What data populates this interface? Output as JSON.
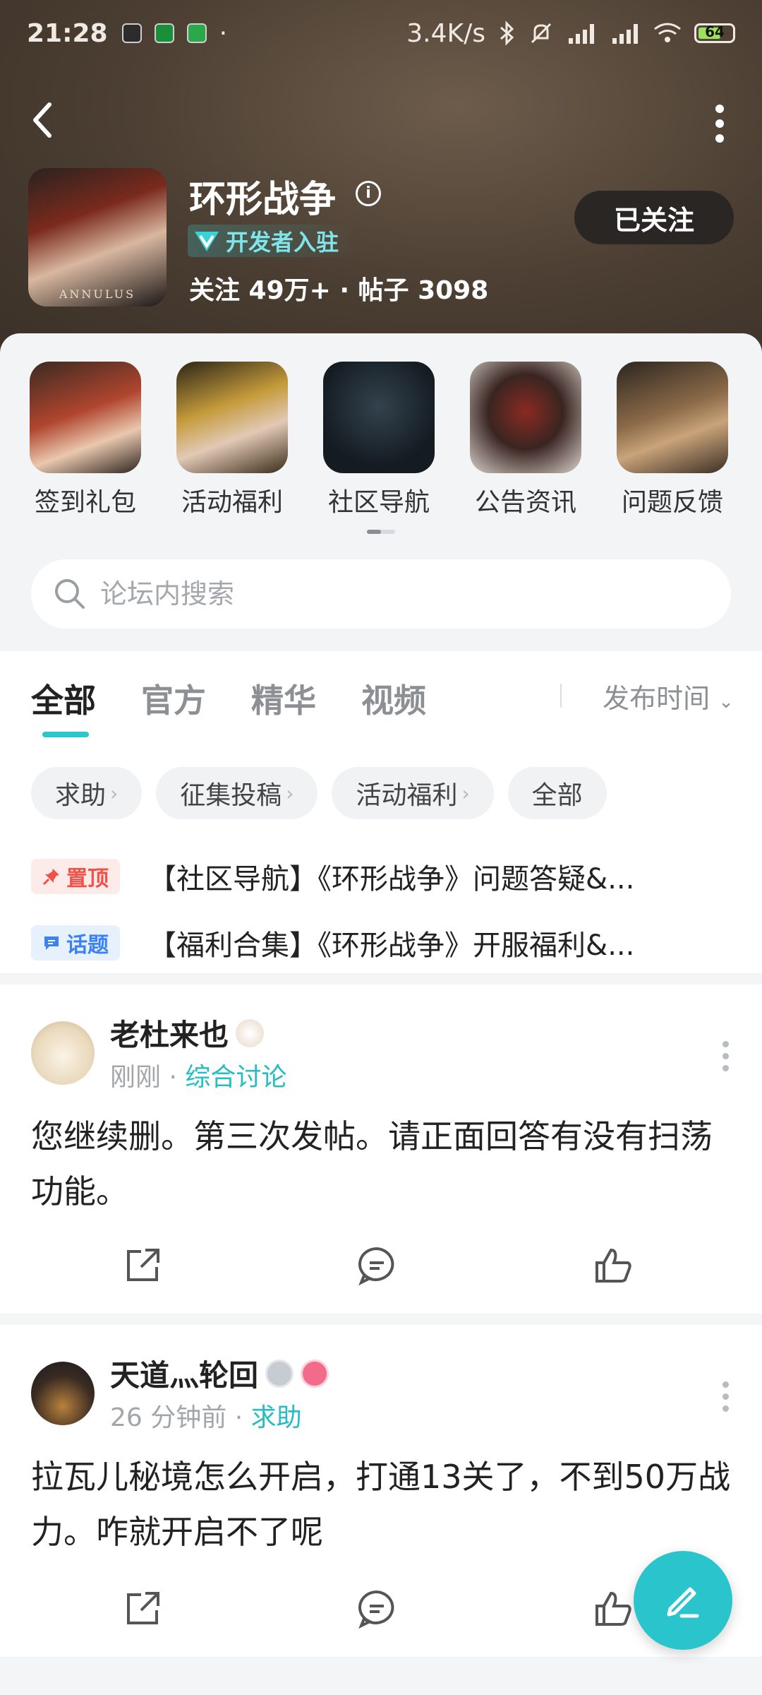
{
  "status_bar": {
    "time": "21:28",
    "net_speed": "3.4K/s",
    "battery": "64"
  },
  "game": {
    "title": "环形战争",
    "dev_badge": "开发者入驻",
    "stats": "关注 49万+ · 帖子 3098",
    "icon_caption": "ANNULUS"
  },
  "header": {
    "follow_label": "已关注"
  },
  "shortcuts": [
    {
      "label": "签到礼包",
      "color": "#7d2a1d"
    },
    {
      "label": "活动福利",
      "color": "#8a6a2a"
    },
    {
      "label": "社区导航",
      "color": "#1e2a33"
    },
    {
      "label": "公告资讯",
      "color": "#4a2a24"
    },
    {
      "label": "问题反馈",
      "color": "#5a4a35"
    }
  ],
  "search": {
    "placeholder": "论坛内搜索"
  },
  "tabs": [
    "全部",
    "官方",
    "精华",
    "视频"
  ],
  "sort_label": "发布时间",
  "chips": [
    {
      "label": "求助",
      "arrow": "›"
    },
    {
      "label": "征集投稿",
      "arrow": "›"
    },
    {
      "label": "活动福利",
      "arrow": "›"
    },
    {
      "label": "全部",
      "arrow": ""
    }
  ],
  "pinned": [
    {
      "tag": "置顶",
      "text": "【社区导航】《环形战争》问题答疑&..."
    },
    {
      "tag": "话题",
      "text": "【福利合集】《环形战争》开服福利&..."
    }
  ],
  "posts": [
    {
      "user": "老杜来也",
      "time": "刚刚",
      "category": "综合讨论",
      "body": "您继续删。第三次发帖。请正面回答有没有扫荡功能。"
    },
    {
      "user": "天道灬轮回",
      "time": "26 分钟前",
      "category": "求助",
      "body": "拉瓦儿秘境怎么开启，打通13关了，不到50万战力。咋就开启不了呢"
    }
  ],
  "colors": {
    "accent": "#2cc7cc",
    "header_bg": "#4a3d31"
  }
}
